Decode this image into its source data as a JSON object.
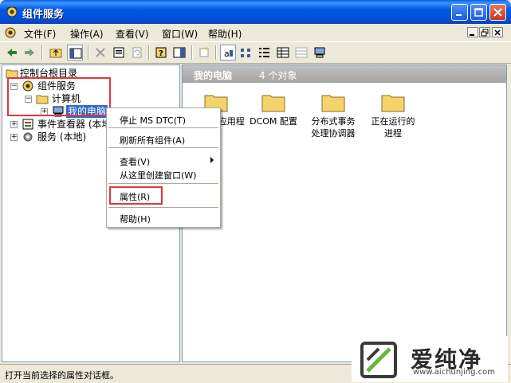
{
  "window": {
    "title": "组件服务"
  },
  "menu": [
    {
      "label": "文件(F)"
    },
    {
      "label": "操作(A)"
    },
    {
      "label": "查看(V)"
    },
    {
      "label": "窗口(W)"
    },
    {
      "label": "帮助(H)"
    }
  ],
  "tree": {
    "root": "控制台根目录",
    "component_services": "组件服务",
    "computers": "计算机",
    "my_computer": "我的电脑",
    "event_viewer": "事件查看器 (本地)",
    "services": "服务 (本地)"
  },
  "right_pane": {
    "header_title": "我的电脑",
    "item_count": "4 个对象",
    "items": [
      {
        "line1": "COM+ 应用程序",
        "line2": ""
      },
      {
        "line1": "DCOM 配置",
        "line2": ""
      },
      {
        "line1": "分布式事务",
        "line2": "处理协调器"
      },
      {
        "line1": "正在运行的",
        "line2": "进程"
      }
    ]
  },
  "context_menu": {
    "stop_dtc": "停止 MS DTC(T)",
    "refresh": "刷新所有组件(A)",
    "view": "查看(V)",
    "new_window": "从这里创建窗口(W)",
    "properties": "属性(R)",
    "help": "帮助(H)"
  },
  "status": {
    "text": "打开当前选择的属性对话框。"
  },
  "watermark": {
    "brand": "爱纯净",
    "url": "www.aichunjing.com"
  },
  "colors": {
    "highlight_red": "#E0373A",
    "selection_blue": "#316AC5",
    "title_blue": "#0058E6"
  }
}
